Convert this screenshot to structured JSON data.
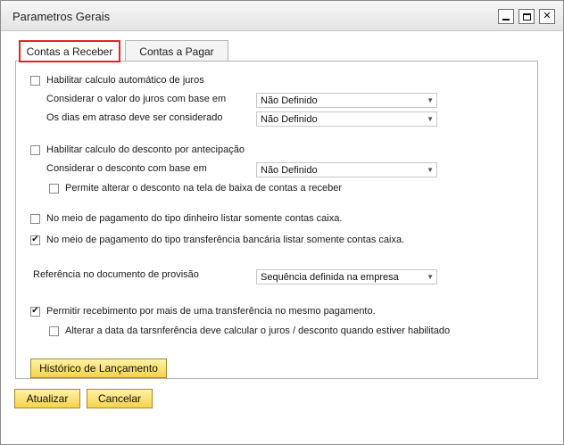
{
  "window": {
    "title": "Parametros Gerais"
  },
  "tabs": [
    {
      "label": "Contas a Receber",
      "active": true
    },
    {
      "label": "Contas a Pagar",
      "active": false
    }
  ],
  "juros": {
    "enable_label": "Habilitar calculo automático de juros",
    "enable_checked": false,
    "base_label": "Considerar o valor do juros com base em",
    "base_value": "Não Definido",
    "dias_label": "Os dias em atraso deve ser considerado",
    "dias_value": "Não Definido"
  },
  "desconto": {
    "enable_label": "Habilitar calculo do desconto por antecipação",
    "enable_checked": false,
    "base_label": "Considerar o desconto com base em",
    "base_value": "Não Definido",
    "permite_label": "Permite alterar o desconto na tela de baixa de contas a receber",
    "permite_checked": false
  },
  "pagamento": {
    "dinheiro_label": "No meio de pagamento do tipo dinheiro listar somente contas caixa.",
    "dinheiro_checked": false,
    "transferencia_label": "No meio de pagamento do tipo transferência bancária listar somente contas caixa.",
    "transferencia_checked": true
  },
  "provisao": {
    "label": "Referência no documento de provisão",
    "value": "Sequência definida na empresa"
  },
  "recebimento": {
    "multi_label": "Permitir recebimento por mais de uma transferência no mesmo pagamento.",
    "multi_checked": true,
    "alterar_label": "Alterar a data da tarsnferência deve calcular o juros / desconto quando estiver habilitado",
    "alterar_checked": false
  },
  "buttons": {
    "historico": "Histórico de Lançamento",
    "atualizar": "Atualizar",
    "cancelar": "Cancelar"
  },
  "colors": {
    "active_tab_border": "#e2242a",
    "button_yellow": "#f5d34a"
  }
}
